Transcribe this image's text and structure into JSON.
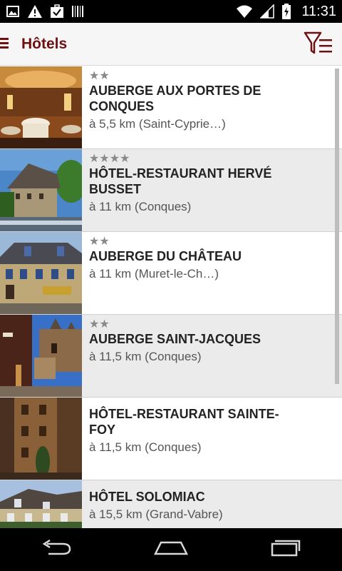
{
  "status_bar": {
    "time": "11:31",
    "icons": [
      "image-icon",
      "warning-icon",
      "briefcase-check-icon",
      "barcode-icon",
      "wifi-icon",
      "signal-icon",
      "battery-charging-icon"
    ]
  },
  "app_bar": {
    "title": "Hôtels",
    "menu_icon": "menu-icon",
    "filter_icon": "filter-list-icon",
    "accent_color": "#6e1010"
  },
  "hotels": [
    {
      "stars": "★★",
      "name": "AUBERGE AUX PORTES DE CONQUES",
      "distance": "à 5,5 km (Saint-Cyprie…)"
    },
    {
      "stars": "★★★★",
      "name": "HÔTEL-RESTAURANT HERVÉ BUSSET",
      "distance": "à 11 km (Conques)"
    },
    {
      "stars": "★★",
      "name": "AUBERGE DU CHÂTEAU",
      "distance": "à 11 km (Muret-le-Ch…)"
    },
    {
      "stars": "★★",
      "name": "AUBERGE SAINT-JACQUES",
      "distance": "à 11,5 km (Conques)"
    },
    {
      "stars": "",
      "name": "HÔTEL-RESTAURANT SAINTE-FOY",
      "distance": "à 11,5 km (Conques)"
    },
    {
      "stars": "",
      "name": "HÔTEL SOLOMIAC",
      "distance": "à 15,5 km (Grand-Vabre)"
    }
  ],
  "nav_bar": {
    "icons": [
      "back-icon",
      "home-icon",
      "recent-apps-icon"
    ]
  }
}
